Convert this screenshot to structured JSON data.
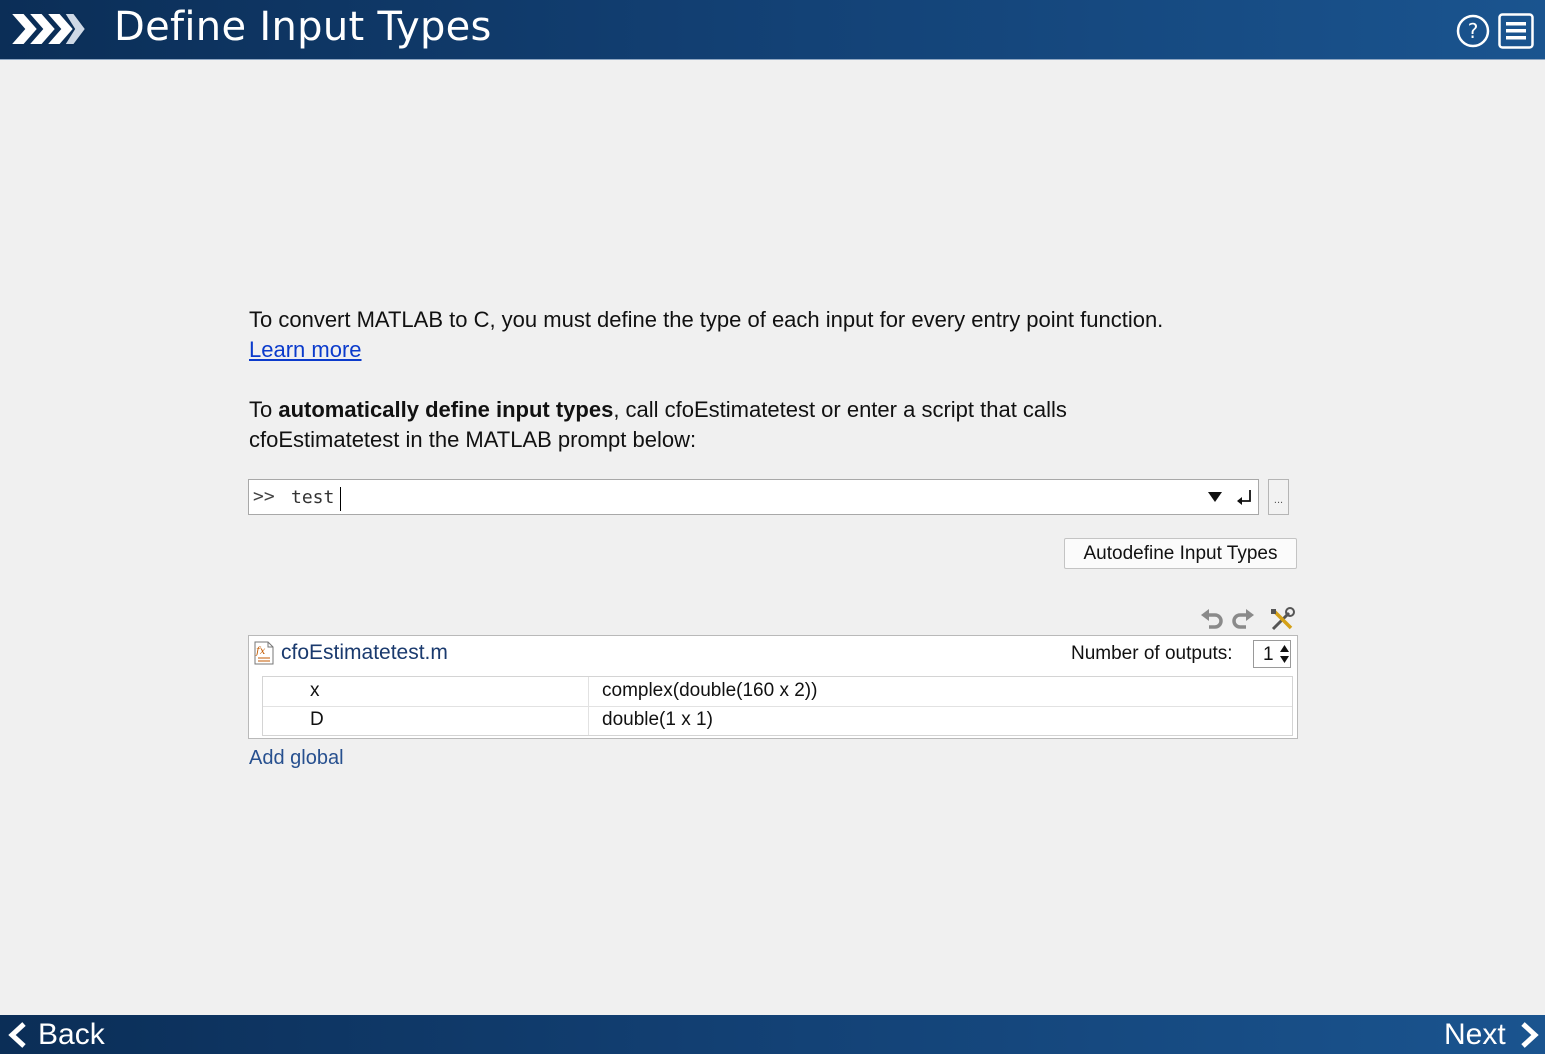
{
  "header": {
    "title": "Define Input Types",
    "help_icon": "help-circle-icon",
    "menu_icon": "hamburger-menu-icon"
  },
  "intro": {
    "line1": "To convert MATLAB to C, you must define the type of each input for every entry point function.",
    "learn_more": "Learn more"
  },
  "auto": {
    "prefix": "To ",
    "bold": "automatically define input types",
    "suffix": ", call cfoEstimatetest or enter a script that calls",
    "line2": "cfoEstimatetest in the MATLAB prompt below:"
  },
  "prompt": {
    "sign": ">>",
    "value": "test",
    "browse_label": "..."
  },
  "autodefine_button": "Autodefine Input Types",
  "function": {
    "file_name": "cfoEstimatetest.m",
    "outputs_label": "Number of outputs:",
    "outputs_value": "1",
    "args": [
      {
        "name": "x",
        "type": "complex(double(160 x 2))"
      },
      {
        "name": "D",
        "type": "double(1 x 1)"
      }
    ]
  },
  "add_global": "Add global",
  "footer": {
    "back": "Back",
    "next": "Next"
  },
  "colors": {
    "header_bg": "#123f72",
    "link": "#0b3bcc",
    "file_name": "#1a3a6e",
    "add_global": "#27508f"
  }
}
